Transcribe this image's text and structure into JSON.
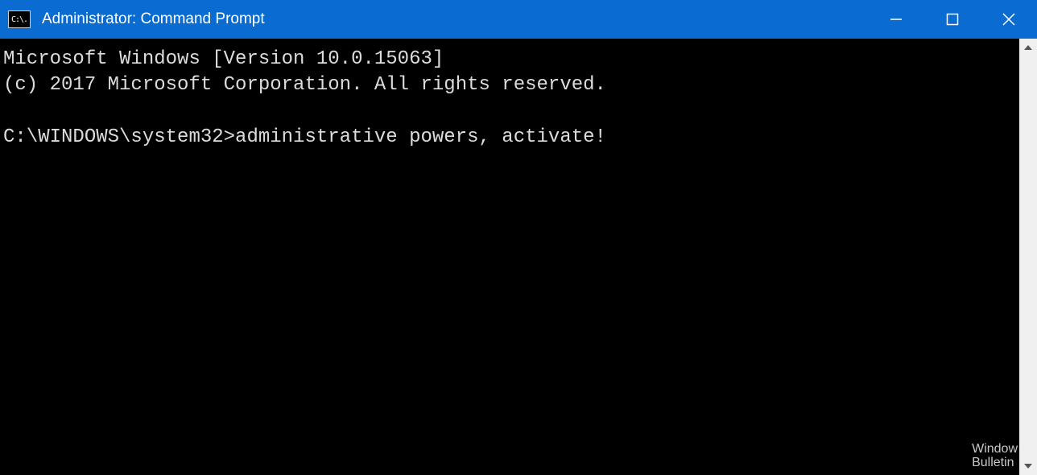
{
  "window": {
    "title": "Administrator: Command Prompt",
    "icon_glyph": "C:\\."
  },
  "terminal": {
    "line1": "Microsoft Windows [Version 10.0.15063]",
    "line2": "(c) 2017 Microsoft Corporation. All rights reserved.",
    "blank": "",
    "prompt": "C:\\WINDOWS\\system32>",
    "command": "administrative powers, activate!"
  },
  "watermark": {
    "line1": "Window",
    "line2": "Bulletin"
  }
}
